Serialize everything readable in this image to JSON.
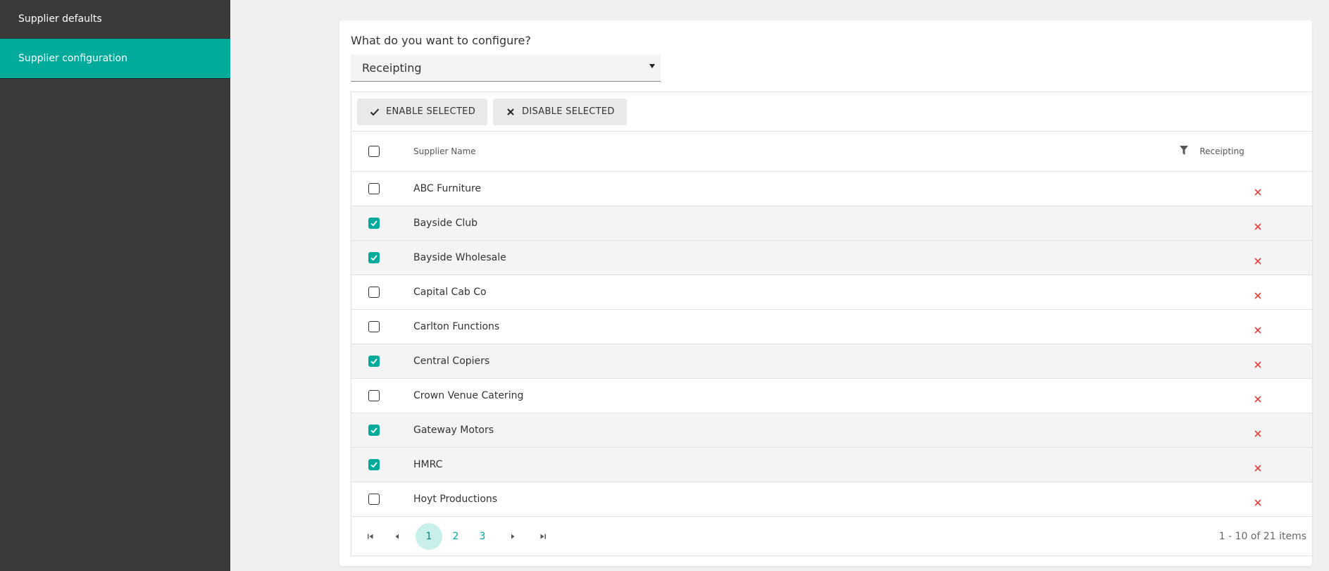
{
  "sidebar": {
    "items": [
      {
        "label": "Supplier defaults",
        "active": false
      },
      {
        "label": "Supplier configuration",
        "active": true
      }
    ]
  },
  "config": {
    "question": "What do you want to configure?",
    "selected": "Receipting"
  },
  "toolbar": {
    "enable_label": "ENABLE SELECTED",
    "disable_label": "DISABLE SELECTED"
  },
  "table": {
    "headers": {
      "name": "Supplier Name",
      "receipting": "Receipting"
    },
    "rows": [
      {
        "name": "ABC Furniture",
        "checked": false,
        "receipting": "disabled"
      },
      {
        "name": "Bayside Club",
        "checked": true,
        "receipting": "disabled"
      },
      {
        "name": "Bayside Wholesale",
        "checked": true,
        "receipting": "disabled"
      },
      {
        "name": "Capital Cab Co",
        "checked": false,
        "receipting": "disabled"
      },
      {
        "name": "Carlton Functions",
        "checked": false,
        "receipting": "disabled"
      },
      {
        "name": "Central Copiers",
        "checked": true,
        "receipting": "disabled"
      },
      {
        "name": "Crown Venue Catering",
        "checked": false,
        "receipting": "disabled"
      },
      {
        "name": "Gateway Motors",
        "checked": true,
        "receipting": "disabled"
      },
      {
        "name": "HMRC",
        "checked": true,
        "receipting": "disabled"
      },
      {
        "name": "Hoyt Productions",
        "checked": false,
        "receipting": "disabled"
      }
    ]
  },
  "pager": {
    "pages": [
      "1",
      "2",
      "3"
    ],
    "current": "1",
    "info": "1 - 10 of 21 items"
  },
  "colors": {
    "accent": "#00ab9c",
    "disabled_mark": "#e0403a",
    "sidebar_bg": "#3a3a3a"
  }
}
